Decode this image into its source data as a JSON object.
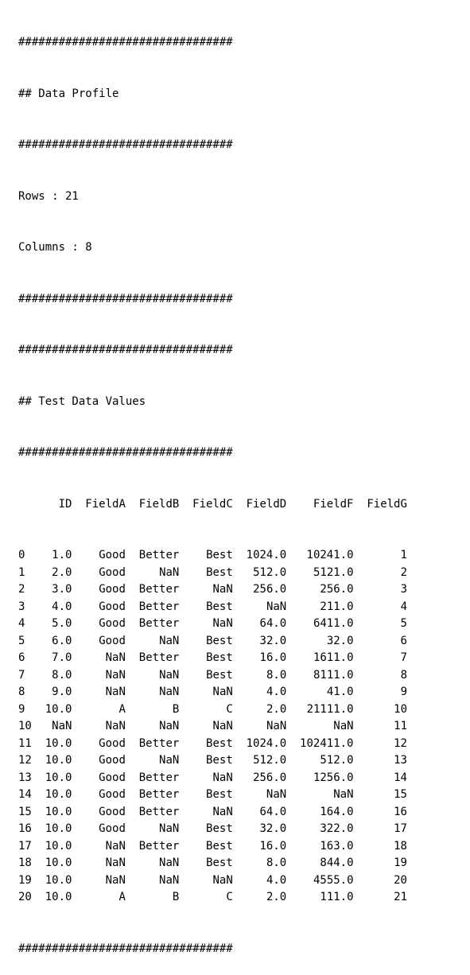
{
  "separator": "################################",
  "profile": {
    "heading": "## Data Profile",
    "rows_line": "Rows : 21",
    "columns_line": "Columns : 8"
  },
  "values": {
    "heading": "## Test Data Values"
  },
  "table": {
    "columns": [
      "ID",
      "FieldA",
      "FieldB",
      "FieldC",
      "FieldD",
      "FieldF",
      "FieldG"
    ],
    "rows": [
      [
        "0",
        "1.0",
        "Good",
        "Better",
        "Best",
        "1024.0",
        "10241.0",
        "1"
      ],
      [
        "1",
        "2.0",
        "Good",
        "NaN",
        "Best",
        "512.0",
        "5121.0",
        "2"
      ],
      [
        "2",
        "3.0",
        "Good",
        "Better",
        "NaN",
        "256.0",
        "256.0",
        "3"
      ],
      [
        "3",
        "4.0",
        "Good",
        "Better",
        "Best",
        "NaN",
        "211.0",
        "4"
      ],
      [
        "4",
        "5.0",
        "Good",
        "Better",
        "NaN",
        "64.0",
        "6411.0",
        "5"
      ],
      [
        "5",
        "6.0",
        "Good",
        "NaN",
        "Best",
        "32.0",
        "32.0",
        "6"
      ],
      [
        "6",
        "7.0",
        "NaN",
        "Better",
        "Best",
        "16.0",
        "1611.0",
        "7"
      ],
      [
        "7",
        "8.0",
        "NaN",
        "NaN",
        "Best",
        "8.0",
        "8111.0",
        "8"
      ],
      [
        "8",
        "9.0",
        "NaN",
        "NaN",
        "NaN",
        "4.0",
        "41.0",
        "9"
      ],
      [
        "9",
        "10.0",
        "A",
        "B",
        "C",
        "2.0",
        "21111.0",
        "10"
      ],
      [
        "10",
        "NaN",
        "NaN",
        "NaN",
        "NaN",
        "NaN",
        "NaN",
        "11"
      ],
      [
        "11",
        "10.0",
        "Good",
        "Better",
        "Best",
        "1024.0",
        "102411.0",
        "12"
      ],
      [
        "12",
        "10.0",
        "Good",
        "NaN",
        "Best",
        "512.0",
        "512.0",
        "13"
      ],
      [
        "13",
        "10.0",
        "Good",
        "Better",
        "NaN",
        "256.0",
        "1256.0",
        "14"
      ],
      [
        "14",
        "10.0",
        "Good",
        "Better",
        "Best",
        "NaN",
        "NaN",
        "15"
      ],
      [
        "15",
        "10.0",
        "Good",
        "Better",
        "NaN",
        "64.0",
        "164.0",
        "16"
      ],
      [
        "16",
        "10.0",
        "Good",
        "NaN",
        "Best",
        "32.0",
        "322.0",
        "17"
      ],
      [
        "17",
        "10.0",
        "NaN",
        "Better",
        "Best",
        "16.0",
        "163.0",
        "18"
      ],
      [
        "18",
        "10.0",
        "NaN",
        "NaN",
        "Best",
        "8.0",
        "844.0",
        "19"
      ],
      [
        "19",
        "10.0",
        "NaN",
        "NaN",
        "NaN",
        "4.0",
        "4555.0",
        "20"
      ],
      [
        "20",
        "10.0",
        "A",
        "B",
        "C",
        "2.0",
        "111.0",
        "21"
      ]
    ]
  }
}
